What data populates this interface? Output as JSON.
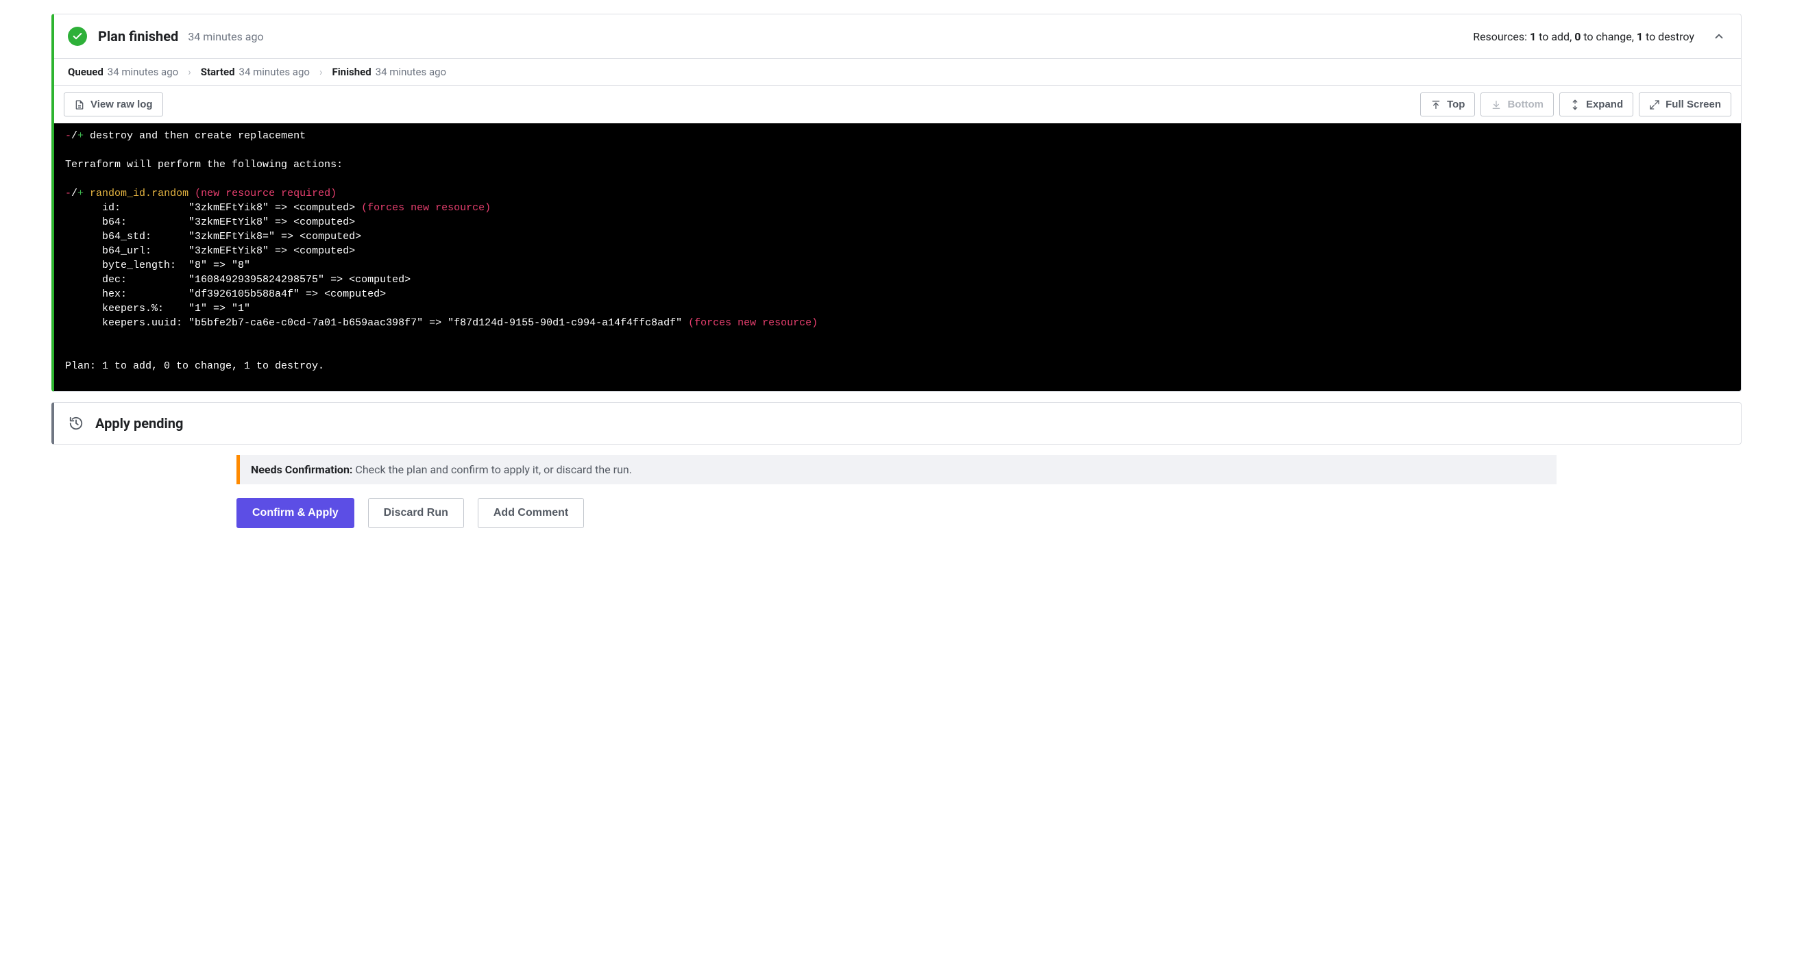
{
  "plan": {
    "title": "Plan finished",
    "time": "34 minutes ago",
    "resources_prefix": "Resources: ",
    "resources_add": "1",
    "resources_add_suffix": " to add, ",
    "resources_change": "0",
    "resources_change_suffix": " to change, ",
    "resources_destroy": "1",
    "resources_destroy_suffix": " to destroy"
  },
  "crumbs": {
    "queued_label": "Queued",
    "queued_time": "34 minutes ago",
    "started_label": "Started",
    "started_time": "34 minutes ago",
    "finished_label": "Finished",
    "finished_time": "34 minutes ago"
  },
  "toolbar": {
    "view_raw_log": "View raw log",
    "top": "Top",
    "bottom": "Bottom",
    "expand": "Expand",
    "full_screen": "Full Screen"
  },
  "terminal": {
    "l1_sym": "-/+",
    "l1_rest": " destroy and then create replacement",
    "blank": "",
    "l2": "Terraform will perform the following actions:",
    "l3_sym": "-/+",
    "l3_name": " random_id.random ",
    "l3_note": "(new resource required)",
    "l4a": "      id:           \"3zkmEFtYik8\" => ",
    "l4b": "<computed>",
    "l4c": " (forces new resource)",
    "l5a": "      b64:          \"3zkmEFtYik8\" => ",
    "l5b": "<computed>",
    "l6a": "      b64_std:      \"3zkmEFtYik8=\" => ",
    "l6b": "<computed>",
    "l7a": "      b64_url:      \"3zkmEFtYik8\" => ",
    "l7b": "<computed>",
    "l8": "      byte_length:  \"8\" => \"8\"",
    "l9a": "      dec:          \"16084929395824298575\" => ",
    "l9b": "<computed>",
    "l10a": "      hex:          \"df3926105b588a4f\" => ",
    "l10b": "<computed>",
    "l11": "      keepers.%:    \"1\" => \"1\"",
    "l12a": "      keepers.uuid: \"b5bfe2b7-ca6e-c0cd-7a01-b659aac398f7\" => \"f87d124d-9155-90d1-c994-a14f4ffc8adf\"",
    "l12b": " (forces new resource)",
    "summary": "Plan: 1 to add, 0 to change, 1 to destroy."
  },
  "apply": {
    "title": "Apply pending"
  },
  "notice": {
    "label": "Needs Confirmation:",
    "message": " Check the plan and confirm to apply it, or discard the run."
  },
  "actions": {
    "confirm": "Confirm & Apply",
    "discard": "Discard Run",
    "add_comment": "Add Comment"
  }
}
